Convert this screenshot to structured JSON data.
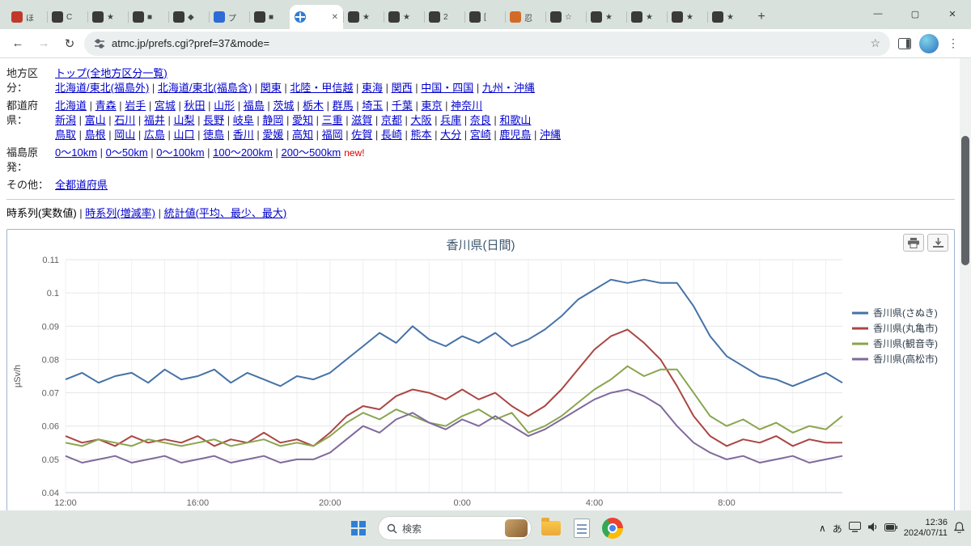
{
  "browser": {
    "tabs": [
      {
        "label": "ほ",
        "fav_color": "#c0392b",
        "fav_kind": "square"
      },
      {
        "label": "C",
        "fav_color": "#3a3a3a",
        "fav_kind": "square"
      },
      {
        "label": "★",
        "fav_color": "#3a3a3a",
        "fav_kind": "square"
      },
      {
        "label": "■",
        "fav_color": "#3a3a3a",
        "fav_kind": "square"
      },
      {
        "label": "◆",
        "fav_color": "#3a3a3a",
        "fav_kind": "square"
      },
      {
        "label": "プ",
        "fav_color": "#2e6bd6",
        "fav_kind": "square"
      },
      {
        "label": "■",
        "fav_color": "#3a3a3a",
        "fav_kind": "square"
      },
      {
        "label": "",
        "fav_color": "#2e7dd1",
        "fav_kind": "globe"
      },
      {
        "label": "★",
        "fav_color": "#3a3a3a",
        "fav_kind": "square"
      },
      {
        "label": "★",
        "fav_color": "#3a3a3a",
        "fav_kind": "square"
      },
      {
        "label": "2",
        "fav_color": "#3a3a3a",
        "fav_kind": "square"
      },
      {
        "label": "[",
        "fav_color": "#3a3a3a",
        "fav_kind": "square"
      },
      {
        "label": "忍",
        "fav_color": "#d46a28",
        "fav_kind": "square"
      },
      {
        "label": "☆",
        "fav_color": "#3a3a3a",
        "fav_kind": "square"
      },
      {
        "label": "★",
        "fav_color": "#3a3a3a",
        "fav_kind": "square"
      },
      {
        "label": "★",
        "fav_color": "#3a3a3a",
        "fav_kind": "square"
      },
      {
        "label": "★",
        "fav_color": "#3a3a3a",
        "fav_kind": "square"
      },
      {
        "label": "★",
        "fav_color": "#3a3a3a",
        "fav_kind": "square"
      }
    ],
    "active_tab_index": 7,
    "new_tab_label": "+",
    "close_glyph": "✕",
    "window_controls": {
      "minimize": "—",
      "maximize": "▢",
      "close": "✕"
    },
    "toolbar": {
      "back": "←",
      "forward": "→",
      "reload": "↻",
      "url": "atmc.jp/prefs.cgi?pref=37&mode=",
      "star": "☆",
      "menu": "⋮"
    }
  },
  "page": {
    "rows": [
      {
        "label": "地方区分：",
        "lines": [
          [
            "トップ(全地方区分一覧)"
          ],
          [
            "北海道/東北(福島外)",
            "北海道/東北(福島含)",
            "関東",
            "北陸・甲信越",
            "東海",
            "関西",
            "中国・四国",
            "九州・沖縄"
          ]
        ]
      },
      {
        "label": "都道府県：",
        "lines": [
          [
            "北海道",
            "青森",
            "岩手",
            "宮城",
            "秋田",
            "山形",
            "福島",
            "茨城",
            "栃木",
            "群馬",
            "埼玉",
            "千葉",
            "東京",
            "神奈川"
          ],
          [
            "新潟",
            "富山",
            "石川",
            "福井",
            "山梨",
            "長野",
            "岐阜",
            "静岡",
            "愛知",
            "三重",
            "滋賀",
            "京都",
            "大阪",
            "兵庫",
            "奈良",
            "和歌山"
          ],
          [
            "鳥取",
            "島根",
            "岡山",
            "広島",
            "山口",
            "徳島",
            "香川",
            "愛媛",
            "高知",
            "福岡",
            "佐賀",
            "長崎",
            "熊本",
            "大分",
            "宮崎",
            "鹿児島",
            "沖縄"
          ]
        ]
      },
      {
        "label": "福島原発：",
        "lines": [
          [
            "0〜10km",
            "0〜50km",
            "0〜100km",
            "100〜200km",
            "200〜500km"
          ]
        ],
        "suffix": "new!"
      },
      {
        "label": "その他：",
        "lines": [
          [
            "全都道府県"
          ]
        ]
      }
    ],
    "view_tabs": {
      "current": "時系列(実数値)",
      "links": [
        "時系列(増減率)",
        "統計値(平均、最少、最大)"
      ]
    }
  },
  "chart_data": {
    "type": "line",
    "title": "香川県(日間)",
    "ylabel": "µSv/h",
    "ylim": [
      0.04,
      0.11
    ],
    "ytick_step": 0.01,
    "grid": true,
    "legend_position": "right",
    "x_start_label": "12:00",
    "x_interval_hours": 0.5,
    "x_tick_labels": [
      "12:00",
      "16:00",
      "20:00",
      "0:00",
      "4:00",
      "8:00"
    ],
    "x_tick_indices": [
      0,
      8,
      16,
      24,
      32,
      40
    ],
    "series": [
      {
        "name": "香川県(さぬき)",
        "color": "#4572A7",
        "values": [
          0.074,
          0.076,
          0.073,
          0.075,
          0.076,
          0.073,
          0.077,
          0.074,
          0.075,
          0.077,
          0.073,
          0.076,
          0.074,
          0.072,
          0.075,
          0.074,
          0.076,
          0.08,
          0.084,
          0.088,
          0.085,
          0.09,
          0.086,
          0.084,
          0.087,
          0.085,
          0.088,
          0.084,
          0.086,
          0.089,
          0.093,
          0.098,
          0.101,
          0.104,
          0.103,
          0.104,
          0.103,
          0.103,
          0.096,
          0.087,
          0.081,
          0.078,
          0.075,
          0.074,
          0.072,
          0.074,
          0.076,
          0.073
        ]
      },
      {
        "name": "香川県(丸亀市)",
        "color": "#AA4643",
        "values": [
          0.057,
          0.055,
          0.056,
          0.054,
          0.057,
          0.055,
          0.056,
          0.055,
          0.057,
          0.054,
          0.056,
          0.055,
          0.058,
          0.055,
          0.056,
          0.054,
          0.058,
          0.063,
          0.066,
          0.065,
          0.069,
          0.071,
          0.07,
          0.068,
          0.071,
          0.068,
          0.07,
          0.066,
          0.063,
          0.066,
          0.071,
          0.077,
          0.083,
          0.087,
          0.089,
          0.085,
          0.08,
          0.072,
          0.063,
          0.057,
          0.054,
          0.056,
          0.055,
          0.057,
          0.054,
          0.056,
          0.055,
          0.055
        ]
      },
      {
        "name": "香川県(観音寺)",
        "color": "#89A54E",
        "values": [
          0.055,
          0.054,
          0.056,
          0.055,
          0.054,
          0.056,
          0.055,
          0.054,
          0.055,
          0.056,
          0.054,
          0.055,
          0.056,
          0.054,
          0.055,
          0.054,
          0.057,
          0.061,
          0.064,
          0.062,
          0.065,
          0.063,
          0.061,
          0.06,
          0.063,
          0.065,
          0.062,
          0.064,
          0.058,
          0.06,
          0.063,
          0.067,
          0.071,
          0.074,
          0.078,
          0.075,
          0.077,
          0.077,
          0.07,
          0.063,
          0.06,
          0.062,
          0.059,
          0.061,
          0.058,
          0.06,
          0.059,
          0.063
        ]
      },
      {
        "name": "香川県(高松市)",
        "color": "#80699B",
        "values": [
          0.051,
          0.049,
          0.05,
          0.051,
          0.049,
          0.05,
          0.051,
          0.049,
          0.05,
          0.051,
          0.049,
          0.05,
          0.051,
          0.049,
          0.05,
          0.05,
          0.052,
          0.056,
          0.06,
          0.058,
          0.062,
          0.064,
          0.061,
          0.059,
          0.062,
          0.06,
          0.063,
          0.06,
          0.057,
          0.059,
          0.062,
          0.065,
          0.068,
          0.07,
          0.071,
          0.069,
          0.066,
          0.06,
          0.055,
          0.052,
          0.05,
          0.051,
          0.049,
          0.05,
          0.051,
          0.049,
          0.05,
          0.051
        ]
      }
    ]
  },
  "taskbar": {
    "search": "検索",
    "caret": "∧",
    "ime": "あ",
    "time": "12:36",
    "date": "2024/07/11"
  }
}
